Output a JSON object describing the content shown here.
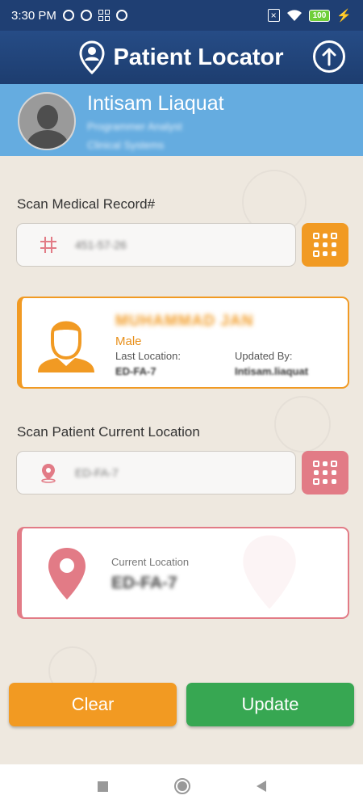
{
  "status_bar": {
    "time": "3:30 PM",
    "battery": "100"
  },
  "app_bar": {
    "title": "Patient Locator"
  },
  "profile": {
    "name": "Intisam Liaquat",
    "title": "Programmer Analyst",
    "department": "Clinical Systems"
  },
  "medical_record": {
    "label": "Scan Medical Record#",
    "value": "451-57-26",
    "accent": "#f19a23"
  },
  "patient_card": {
    "name": "MUHAMMAD  JAN",
    "gender": "Male",
    "last_location_label": "Last Location:",
    "last_location_value": "ED-FA-7",
    "updated_by_label": "Updated By:",
    "updated_by_value": "Intisam.liaquat"
  },
  "current_location": {
    "label": "Scan Patient Current Location",
    "value": "ED-FA-7",
    "accent": "#e27b86"
  },
  "current_card": {
    "label": "Current Location",
    "value": "ED-FA-7"
  },
  "buttons": {
    "clear": "Clear",
    "update": "Update"
  },
  "colors": {
    "header": "#1f3f73",
    "profile": "#65ace0",
    "clear": "#f29a22",
    "update": "#37a752"
  }
}
